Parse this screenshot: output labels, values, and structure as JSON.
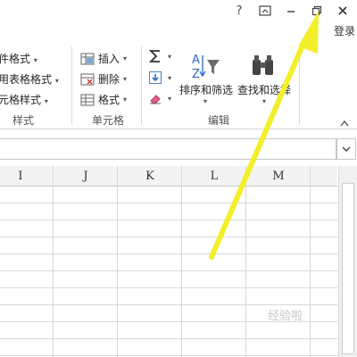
{
  "window_controls": {
    "help": "?",
    "ribbon_display": "ribbon-display-options-icon",
    "minimize": "minimize-icon",
    "restore": "restore-icon",
    "close": "close-icon",
    "signin_label": "登录"
  },
  "styles_group": {
    "items": [
      {
        "label": "件格式"
      },
      {
        "label": "用表格格式"
      },
      {
        "label": "元格样式"
      }
    ],
    "group_label": "样式"
  },
  "cells_group": {
    "insert_label": "插入",
    "delete_label": "删除",
    "format_label": "格式",
    "group_label": "单元格"
  },
  "editing_group": {
    "sort_filter_label": "排序和筛选",
    "find_select_label": "查找和选择",
    "group_label": "编辑"
  },
  "grid": {
    "columns": [
      "I",
      "J",
      "K",
      "L",
      "M"
    ]
  },
  "watermark": "经验啦",
  "colors": {
    "arrow": "#f2ef2a",
    "ribbon_bg": "#ffffff",
    "grid_line": "#d8d8d8"
  }
}
